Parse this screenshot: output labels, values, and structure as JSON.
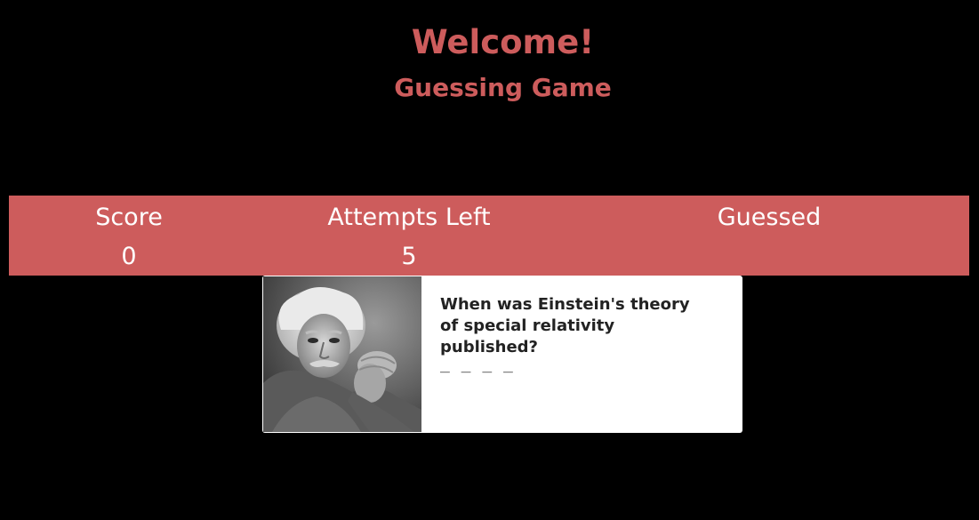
{
  "header": {
    "title": "Welcome!",
    "subtitle": "Guessing Game"
  },
  "stats": {
    "score_label": "Score",
    "score_value": "0",
    "attempts_label": "Attempts Left",
    "attempts_value": "5",
    "guessed_label": "Guessed",
    "guessed_value": ""
  },
  "question_card": {
    "image_subject": "portrait-photo",
    "question": "When was Einstein's theory of special relativity published?",
    "answer_blanks": "_ _ _ _"
  },
  "colors": {
    "background": "#000000",
    "accent": "#cd5c5c",
    "card": "#ffffff",
    "stat_text": "#ffffff"
  }
}
